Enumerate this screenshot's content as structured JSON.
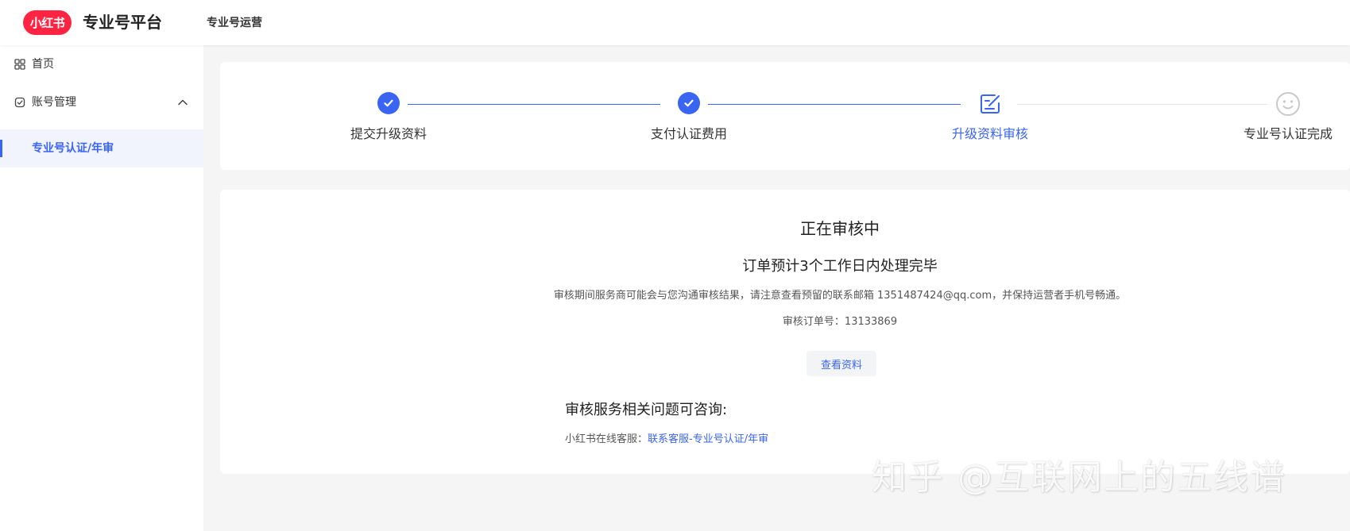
{
  "header": {
    "logo_text": "小红书",
    "brand": "专业号平台",
    "nav_item": "专业号运营"
  },
  "sidebar": {
    "items": [
      {
        "label": "首页",
        "icon": "grid-icon"
      },
      {
        "label": "账号管理",
        "icon": "account-icon",
        "expanded": true
      },
      {
        "label": "专业号认证/年审",
        "active": true
      }
    ]
  },
  "steps": [
    {
      "label": "提交升级资料",
      "state": "done"
    },
    {
      "label": "支付认证费用",
      "state": "done"
    },
    {
      "label": "升级资料审核",
      "state": "current"
    },
    {
      "label": "专业号认证完成",
      "state": "pending"
    }
  ],
  "review": {
    "title": "正在审核中",
    "subtitle": "订单预计3个工作日内处理完毕",
    "description": "审核期间服务商可能会与您沟通审核结果，请注意查看预留的联系邮箱 1351487424@qq.com，并保持运营者手机号畅通。",
    "order_label": "审核订单号：",
    "order_number": "13133869",
    "view_button": "查看资料"
  },
  "consult": {
    "heading": "审核服务相关问题可咨询:",
    "service_label": "小红书在线客服：",
    "service_link": "联系客服-专业号认证/年审"
  },
  "watermark": "知乎 @互联网上的五线谱",
  "colors": {
    "brand_red": "#ff2442",
    "accent_blue": "#3a64f2",
    "pending_gray": "#c9c9c9"
  }
}
